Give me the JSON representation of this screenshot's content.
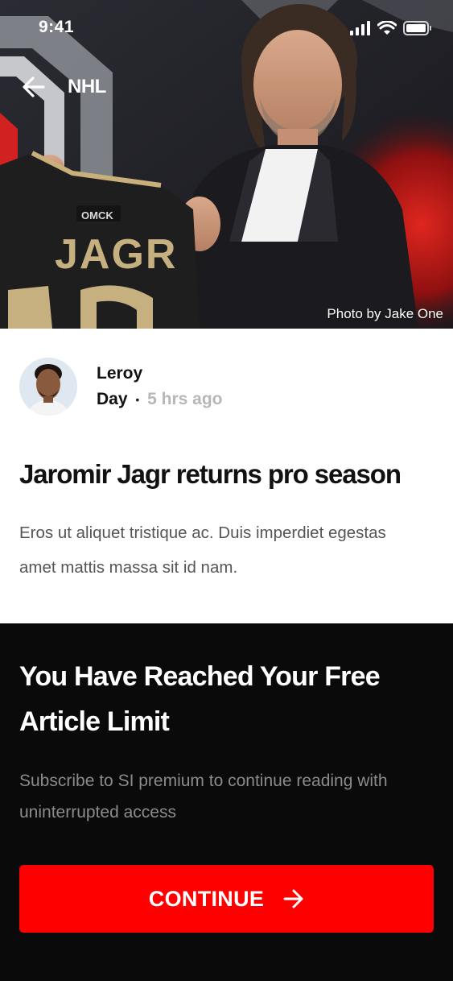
{
  "status_bar": {
    "time": "9:41"
  },
  "nav": {
    "section": "NHL"
  },
  "hero": {
    "photo_credit": "Photo by Jake One",
    "jersey_sponsor": "OMCK",
    "jersey_name": "JAGR"
  },
  "author": {
    "first_name": "Leroy",
    "last_name": "Day",
    "separator": "•",
    "posted": "5 hrs ago"
  },
  "article": {
    "headline": "Jaromir Jagr returns pro season",
    "excerpt": "Eros ut aliquet tristique ac. Duis imperdiet egestas amet mattis massa sit id nam."
  },
  "paywall": {
    "title": "You Have Reached Your Free Article Limit",
    "subtitle": "Subscribe to SI premium to continue reading with uninterrupted access",
    "button_label": "CONTINUE"
  },
  "colors": {
    "accent": "#ff0000",
    "paywall_bg": "#0a0a0a",
    "muted_text": "#8b8b8b",
    "timestamp": "#b7b7b7"
  },
  "icons": [
    "signal-icon",
    "wifi-icon",
    "battery-icon",
    "back-arrow-icon",
    "arrow-right-icon"
  ]
}
